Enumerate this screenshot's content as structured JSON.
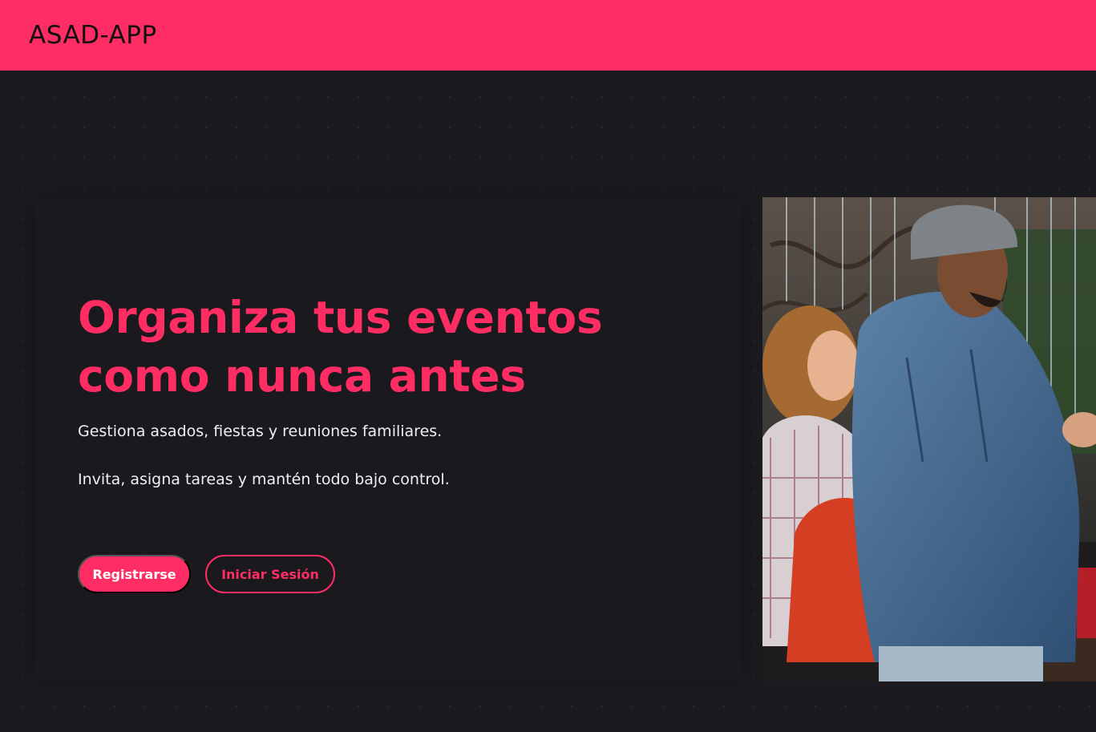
{
  "header": {
    "brand": "ASAD-APP"
  },
  "hero": {
    "title": "Organiza tus eventos como nunca antes",
    "subtitle_1": "Gestiona asados, fiestas y reuniones familiares.",
    "subtitle_2": "Invita, asigna tareas y mantén todo bajo control.",
    "register_label": "Registrarse",
    "login_label": "Iniciar Sesión",
    "image_icon": "photo-people-gathering"
  },
  "colors": {
    "accent": "#ff2d63",
    "background": "#1b1a1f",
    "text": "#f0eef0"
  }
}
